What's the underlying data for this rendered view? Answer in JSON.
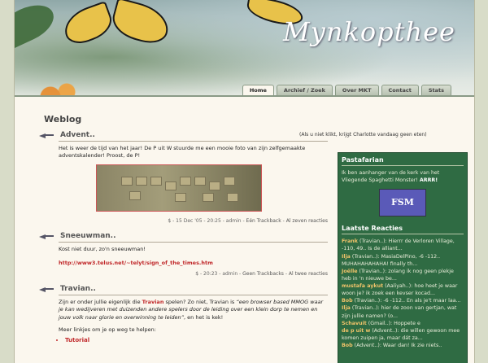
{
  "site": {
    "logo": "Mynkopthee"
  },
  "nav": {
    "tabs": [
      {
        "label": "Home"
      },
      {
        "label": "Archief / Zoek"
      },
      {
        "label": "Over MKT"
      },
      {
        "label": "Contact"
      },
      {
        "label": "Stats"
      }
    ]
  },
  "notice": "(Als u niet klikt, krijgt Charlotte vandaag geen eten)",
  "main": {
    "heading": "Weblog",
    "posts": [
      {
        "title": "Advent..",
        "body": "Het is weer de tijd van het jaar! De P uit W stuurde me een mooie foto van zijn zelfgemaakte adventskalender! Proost, de P!",
        "meta_prefix": "$ - 15 Dec '05 - 20:25 - admin - ",
        "meta_link1": "Eén Trackback",
        "meta_link2": "Al zeven reacties"
      },
      {
        "title": "Sneeuwman..",
        "body": "Kost niet duur, zo'n sneeuwman!",
        "link": "http://www3.telus.net/~telyt/sign_of_the_times.htm",
        "meta_prefix": "$ - 20:23 - admin - ",
        "meta_link1": "Geen Trackbacks",
        "meta_link2": "Al twee reacties"
      },
      {
        "title": "Travian..",
        "body_pre": "Zijn er onder jullie eigenlijk die ",
        "body_link": "Travian",
        "body_mid": " spelen? Zo niet, Travian is ",
        "body_quote": "“een browser based MMOG waar je kan wedijveren met duizenden andere spelers door de leiding over een klein dorp te nemen en jouw volk naar glorie en overwinning te leiden”",
        "body_post": ", en het is kek!",
        "body2": "Meer linkjes om je op weg te helpen:",
        "list": [
          "Tutorial"
        ]
      }
    ]
  },
  "sidebar": {
    "pasta_heading": "Pastafarian",
    "pasta_text_pre": "Ik ben aanhanger van de kerk van het Vliegende Spaghetti Monster! ",
    "pasta_text_bold": "ARRR!",
    "fsm_label": "FSM",
    "reacties_heading": "Laatste Reacties",
    "reacties": [
      {
        "who": "Frank",
        "text": " (Travian..): Hierrr de Verloren Village, -110, 49.. Is de alliant..."
      },
      {
        "who": "Ilja",
        "text": " (Travian..): MasiaDelPino, -6 -112.. MUHAHAHAHAHA! finally th..."
      },
      {
        "who": "Joëlle",
        "text": " (Travian..): zolang ik nog geen plekje heb in 'n nieuwe be..."
      },
      {
        "who": "mustafa aykut",
        "text": " (Aaliyah..): hoe heet je waar woon je? ik zoek een kevser kocad..."
      },
      {
        "who": "Bob",
        "text": " (Travian..): -6 -112.. En als je't maar laa..."
      },
      {
        "who": "Ilja",
        "text": " (Travian..): hier de zoon van gertjan, wat zijn jullie namen? (o..."
      },
      {
        "who": "Schavuit",
        "text": " (Gmail..): Hoppete e"
      },
      {
        "who": "de p uit w",
        "text": " (Advent..): die willen gewoon mee komen zuipen ja, maar dát za..."
      },
      {
        "who": "Bob",
        "text": " (Advent..): Waar dan! Ik zie niets.."
      }
    ]
  }
}
